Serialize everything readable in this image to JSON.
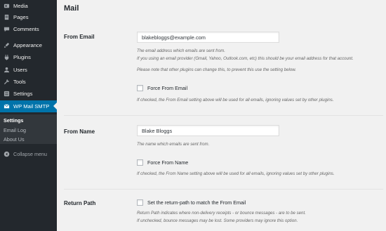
{
  "sidebar": {
    "items": [
      {
        "label": "Media",
        "icon": "media-icon"
      },
      {
        "label": "Pages",
        "icon": "pages-icon"
      },
      {
        "label": "Comments",
        "icon": "comments-icon"
      },
      {
        "label": "Appearance",
        "icon": "appearance-icon"
      },
      {
        "label": "Plugins",
        "icon": "plugins-icon"
      },
      {
        "label": "Users",
        "icon": "users-icon"
      },
      {
        "label": "Tools",
        "icon": "tools-icon"
      },
      {
        "label": "Settings",
        "icon": "settings-icon"
      },
      {
        "label": "WP Mail SMTP",
        "icon": "mail-icon",
        "active": true
      }
    ],
    "submenu": [
      {
        "label": "Settings",
        "current": true
      },
      {
        "label": "Email Log"
      },
      {
        "label": "About Us"
      }
    ],
    "collapse_label": "Collapse menu",
    "active_color": "#0073aa",
    "background_color": "#23282d"
  },
  "main": {
    "title": "Mail",
    "from_email": {
      "label": "From Email",
      "value": "blakebloggs@example.com",
      "desc1": "The email address which emails are sent from.",
      "desc2": "If you using an email provider (Gmail, Yahoo, Outlook.com, etc) this should be your email address for that account.",
      "note": "Please note that other plugins can change this, to prevent this use the setting below.",
      "force_label": "Force From Email",
      "force_checked": false,
      "force_desc": "If checked, the From Email setting above will be used for all emails, ignoring values set by other plugins."
    },
    "from_name": {
      "label": "From Name",
      "value": "Blake Bloggs",
      "desc": "The name which emails are sent from.",
      "force_label": "Force From Name",
      "force_checked": false,
      "force_desc": "If checked, the From Name setting above will be used for all emails, ignoring values set by other plugins."
    },
    "return_path": {
      "label": "Return Path",
      "check_label": "Set the return-path to match the From Email",
      "checked": false,
      "desc1": "Return Path indicates where non-delivery receipts - or bounce messages - are to be sent.",
      "desc2": "If unchecked, bounce messages may be lost. Some providers may ignore this option."
    }
  }
}
